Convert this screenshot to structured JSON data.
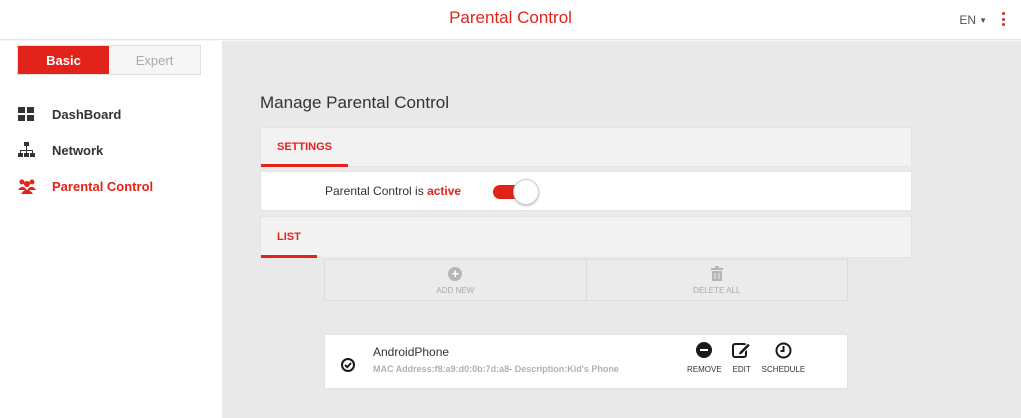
{
  "header": {
    "title": "Parental Control",
    "language": "EN",
    "menu_icon": "kebab-vertical-icon",
    "accent_color": "#e2231a"
  },
  "mode_switch": {
    "basic_label": "Basic",
    "expert_label": "Expert",
    "selected": "Basic"
  },
  "sidebar": {
    "items": [
      {
        "label": "DashBoard",
        "icon": "dashboard-icon",
        "active": false
      },
      {
        "label": "Network",
        "icon": "network-icon",
        "active": false
      },
      {
        "label": "Parental Control",
        "icon": "users-icon",
        "active": true
      }
    ]
  },
  "main": {
    "page_title": "Manage Parental Control",
    "settings_tab": "SETTINGS",
    "status_prefix": "Parental Control is",
    "status_value": "active",
    "toggle_on": true,
    "list_tab": "LIST",
    "add_new_label": "ADD NEW",
    "delete_all_label": "DELETE ALL",
    "devices": [
      {
        "name": "AndroidPhone",
        "details": "MAC Address:f8:a9:d0:0b:7d:a8- Description:Kid's Phone",
        "selected": true,
        "remove_label": "REMOVE",
        "edit_label": "EDIT",
        "schedule_label": "SCHEDULE"
      }
    ]
  }
}
